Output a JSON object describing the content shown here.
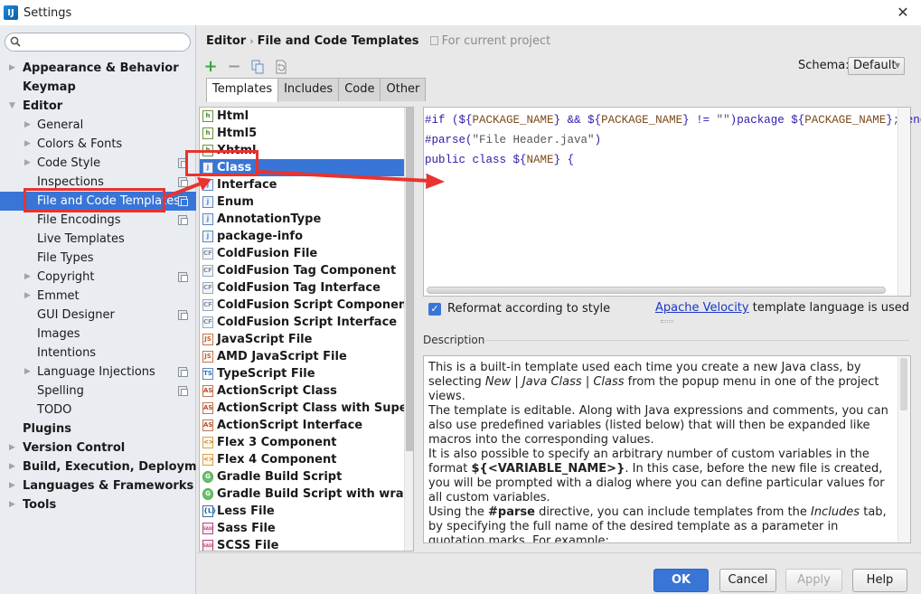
{
  "window": {
    "title": "Settings",
    "logo_text": "IJ",
    "close_icon": "close-icon"
  },
  "search": {
    "placeholder": "",
    "value": ""
  },
  "sidebar": {
    "items": [
      {
        "label": "Appearance & Behavior",
        "level": 0,
        "expandable": true,
        "expanded": false,
        "project_icon": false,
        "selected": false
      },
      {
        "label": "Keymap",
        "level": 0,
        "expandable": false,
        "project_icon": false,
        "selected": false
      },
      {
        "label": "Editor",
        "level": 0,
        "expandable": true,
        "expanded": true,
        "project_icon": false,
        "selected": false
      },
      {
        "label": "General",
        "level": 1,
        "expandable": true,
        "expanded": false,
        "project_icon": false,
        "selected": false
      },
      {
        "label": "Colors & Fonts",
        "level": 1,
        "expandable": true,
        "expanded": false,
        "project_icon": false,
        "selected": false
      },
      {
        "label": "Code Style",
        "level": 1,
        "expandable": true,
        "expanded": false,
        "project_icon": true,
        "selected": false
      },
      {
        "label": "Inspections",
        "level": 1,
        "expandable": false,
        "project_icon": true,
        "selected": false
      },
      {
        "label": "File and Code Templates",
        "level": 1,
        "expandable": false,
        "project_icon": true,
        "selected": true
      },
      {
        "label": "File Encodings",
        "level": 1,
        "expandable": false,
        "project_icon": true,
        "selected": false
      },
      {
        "label": "Live Templates",
        "level": 1,
        "expandable": false,
        "project_icon": false,
        "selected": false
      },
      {
        "label": "File Types",
        "level": 1,
        "expandable": false,
        "project_icon": false,
        "selected": false
      },
      {
        "label": "Copyright",
        "level": 1,
        "expandable": true,
        "expanded": false,
        "project_icon": true,
        "selected": false
      },
      {
        "label": "Emmet",
        "level": 1,
        "expandable": true,
        "expanded": false,
        "project_icon": false,
        "selected": false
      },
      {
        "label": "GUI Designer",
        "level": 1,
        "expandable": false,
        "project_icon": true,
        "selected": false
      },
      {
        "label": "Images",
        "level": 1,
        "expandable": false,
        "project_icon": false,
        "selected": false
      },
      {
        "label": "Intentions",
        "level": 1,
        "expandable": false,
        "project_icon": false,
        "selected": false
      },
      {
        "label": "Language Injections",
        "level": 1,
        "expandable": true,
        "expanded": false,
        "project_icon": true,
        "selected": false
      },
      {
        "label": "Spelling",
        "level": 1,
        "expandable": false,
        "project_icon": true,
        "selected": false
      },
      {
        "label": "TODO",
        "level": 1,
        "expandable": false,
        "project_icon": false,
        "selected": false
      },
      {
        "label": "Plugins",
        "level": 0,
        "expandable": false,
        "project_icon": false,
        "selected": false
      },
      {
        "label": "Version Control",
        "level": 0,
        "expandable": true,
        "expanded": false,
        "project_icon": false,
        "selected": false
      },
      {
        "label": "Build, Execution, Deployment",
        "level": 0,
        "expandable": true,
        "expanded": false,
        "project_icon": false,
        "selected": false
      },
      {
        "label": "Languages & Frameworks",
        "level": 0,
        "expandable": true,
        "expanded": false,
        "project_icon": false,
        "selected": false
      },
      {
        "label": "Tools",
        "level": 0,
        "expandable": true,
        "expanded": false,
        "project_icon": false,
        "selected": false
      }
    ]
  },
  "header": {
    "breadcrumb_parent": "Editor",
    "breadcrumb_separator": "›",
    "breadcrumb_current": "File and Code Templates",
    "scope_note": "For current project"
  },
  "toolbar": {
    "add": "+",
    "remove": "−",
    "copy_icon": "copy-icon",
    "reset_icon": "reset-icon"
  },
  "schema": {
    "label": "Schema:",
    "selected": "Default"
  },
  "tabs": [
    {
      "label": "Templates",
      "active": true
    },
    {
      "label": "Includes",
      "active": false
    },
    {
      "label": "Code",
      "active": false
    },
    {
      "label": "Other",
      "active": false
    }
  ],
  "templates": [
    {
      "label": "Html",
      "icon": "html",
      "icon_text": "h",
      "selected": false
    },
    {
      "label": "Html5",
      "icon": "html",
      "icon_text": "h",
      "selected": false
    },
    {
      "label": "Xhtml",
      "icon": "html",
      "icon_text": "h",
      "selected": false
    },
    {
      "label": "Class",
      "icon": "java",
      "icon_text": "j",
      "selected": true
    },
    {
      "label": "Interface",
      "icon": "java",
      "icon_text": "j",
      "selected": false
    },
    {
      "label": "Enum",
      "icon": "java",
      "icon_text": "j",
      "selected": false
    },
    {
      "label": "AnnotationType",
      "icon": "java",
      "icon_text": "j",
      "selected": false
    },
    {
      "label": "package-info",
      "icon": "java",
      "icon_text": "j",
      "selected": false
    },
    {
      "label": "ColdFusion File",
      "icon": "cf",
      "icon_text": "CF",
      "selected": false
    },
    {
      "label": "ColdFusion Tag Component",
      "icon": "cf",
      "icon_text": "CF",
      "selected": false
    },
    {
      "label": "ColdFusion Tag Interface",
      "icon": "cf",
      "icon_text": "CF",
      "selected": false
    },
    {
      "label": "ColdFusion Script Component",
      "icon": "cf",
      "icon_text": "CF",
      "selected": false
    },
    {
      "label": "ColdFusion Script Interface",
      "icon": "cf",
      "icon_text": "CF",
      "selected": false
    },
    {
      "label": "JavaScript File",
      "icon": "js",
      "icon_text": "JS",
      "selected": false
    },
    {
      "label": "AMD JavaScript File",
      "icon": "js",
      "icon_text": "JS",
      "selected": false
    },
    {
      "label": "TypeScript File",
      "icon": "ts",
      "icon_text": "TS",
      "selected": false
    },
    {
      "label": "ActionScript Class",
      "icon": "as",
      "icon_text": "AS",
      "selected": false
    },
    {
      "label": "ActionScript Class with Supers",
      "icon": "as",
      "icon_text": "AS",
      "selected": false
    },
    {
      "label": "ActionScript Interface",
      "icon": "as",
      "icon_text": "AS",
      "selected": false
    },
    {
      "label": "Flex 3 Component",
      "icon": "flex",
      "icon_text": "<>",
      "selected": false
    },
    {
      "label": "Flex 4 Component",
      "icon": "flex",
      "icon_text": "<>",
      "selected": false
    },
    {
      "label": "Gradle Build Script",
      "icon": "gradle",
      "icon_text": "G",
      "selected": false
    },
    {
      "label": "Gradle Build Script with wrapper",
      "icon": "gradle",
      "icon_text": "G",
      "selected": false
    },
    {
      "label": "Less File",
      "icon": "less",
      "icon_text": "{L}",
      "selected": false
    },
    {
      "label": "Sass File",
      "icon": "sass",
      "icon_text": "SASS",
      "selected": false
    },
    {
      "label": "SCSS File",
      "icon": "sass",
      "icon_text": "SASS",
      "selected": false
    }
  ],
  "editor": {
    "lines": [
      [
        {
          "t": "#if",
          "c": "kw"
        },
        {
          "t": " (",
          "c": "op"
        },
        {
          "t": "${",
          "c": "op"
        },
        {
          "t": "PACKAGE_NAME",
          "c": "var"
        },
        {
          "t": "}",
          "c": "op"
        },
        {
          "t": " && ",
          "c": "op"
        },
        {
          "t": "${",
          "c": "op"
        },
        {
          "t": "PACKAGE_NAME",
          "c": "var"
        },
        {
          "t": "}",
          "c": "op"
        },
        {
          "t": " != ",
          "c": "op"
        },
        {
          "t": "\"\"",
          "c": "str"
        },
        {
          "t": ")",
          "c": "op"
        },
        {
          "t": "package ",
          "c": "kw"
        },
        {
          "t": "${",
          "c": "op"
        },
        {
          "t": "PACKAGE_NAME",
          "c": "var"
        },
        {
          "t": "}",
          "c": "op"
        },
        {
          "t": ";",
          "c": "str"
        },
        {
          "t": "#end",
          "c": "kw"
        }
      ],
      [
        {
          "t": "#parse",
          "c": "kw"
        },
        {
          "t": "(",
          "c": "op"
        },
        {
          "t": "\"File Header.java\"",
          "c": "str"
        },
        {
          "t": ")",
          "c": "op"
        }
      ],
      [
        {
          "t": "public class ",
          "c": "kw"
        },
        {
          "t": "${",
          "c": "op"
        },
        {
          "t": "NAME",
          "c": "var"
        },
        {
          "t": "}",
          "c": "op"
        },
        {
          "t": " {",
          "c": "op"
        }
      ],
      [
        {
          "t": "}",
          "c": "op"
        }
      ]
    ]
  },
  "options": {
    "reformat_label": "Reformat according to style",
    "reformat_checked": true,
    "velocity_link": "Apache Velocity",
    "velocity_suffix": " template language is used"
  },
  "description": {
    "title": "Description",
    "paragraphs": [
      [
        {
          "t": "This is a built-in template used each time you create a new Java class, by selecting "
        },
        {
          "t": "New",
          "s": "i"
        },
        {
          "t": " | "
        },
        {
          "t": "Java Class",
          "s": "i"
        },
        {
          "t": " | "
        },
        {
          "t": "Class",
          "s": "i"
        },
        {
          "t": " from the popup menu in one of the project views."
        }
      ],
      [
        {
          "t": "The template is editable. Along with Java expressions and comments, you can also use predefined variables (listed below) that will then be expanded like macros into the corresponding values."
        }
      ],
      [
        {
          "t": "It is also possible to specify an arbitrary number of custom variables in the format "
        },
        {
          "t": "${<VARIABLE_NAME>}",
          "s": "b"
        },
        {
          "t": ". In this case, before the new file is created, you will be prompted with a dialog where you can define particular values for all custom variables."
        }
      ],
      [
        {
          "t": "Using the "
        },
        {
          "t": "#parse",
          "s": "b"
        },
        {
          "t": " directive, you can include templates from the "
        },
        {
          "t": "Includes",
          "s": "i"
        },
        {
          "t": " tab, by specifying the full name of the desired template as a parameter in quotation marks. For example:"
        }
      ]
    ]
  },
  "buttons": {
    "ok": "OK",
    "cancel": "Cancel",
    "apply": "Apply",
    "help": "Help"
  },
  "colors": {
    "selection": "#3875d7",
    "annotation": "#e8332f",
    "link": "#1a37c4"
  }
}
